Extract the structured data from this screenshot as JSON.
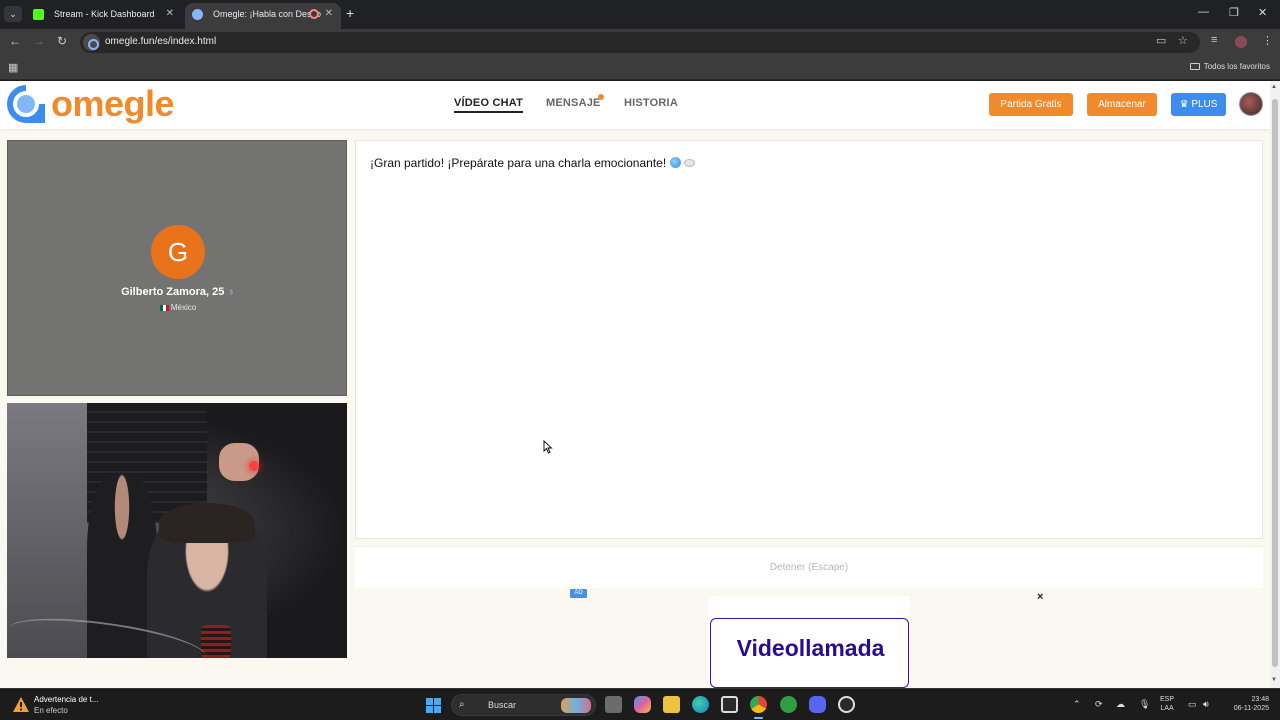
{
  "browser": {
    "tabs": [
      {
        "title": "Stream - Kick Dashboard",
        "favicon_color": "#53fc18"
      },
      {
        "title": "Omegle: ¡Habla con Desco",
        "favicon_color": "#8ab4f8",
        "recording": true
      }
    ],
    "url": "omegle.fun/es/index.html",
    "bookmarks_all": "Todos los favoritos"
  },
  "site": {
    "logo_text": "omegle",
    "nav": [
      {
        "label": "VÍDEO CHAT",
        "active": true
      },
      {
        "label": "MENSAJE",
        "has_dot": true
      },
      {
        "label": "HISTORIA"
      }
    ],
    "buttons": {
      "free_match": "Partida Gratis",
      "store": "Almacenar",
      "plus": "PLUS"
    }
  },
  "stranger": {
    "initial": "G",
    "name": "Gilberto Zamora, 25",
    "country": "México",
    "avatar_color": "#e8731a"
  },
  "chat": {
    "message": "¡Gran partido! ¡Prepárate para una charla emocionante!"
  },
  "controls": {
    "stop_label": "Detener (Escape)"
  },
  "ad": {
    "badge": "AD",
    "close": "×",
    "title": "Videollamada"
  },
  "taskbar": {
    "notification_title": "Advertencia de t...",
    "notification_sub": "En efecto",
    "search_placeholder": "Buscar",
    "lang_top": "ESP",
    "lang_bottom": "LAA",
    "time": "23:48",
    "date": "06-11-2025"
  },
  "colors": {
    "brand_orange": "#f08a2b",
    "plus_blue": "#3d8cf0"
  }
}
